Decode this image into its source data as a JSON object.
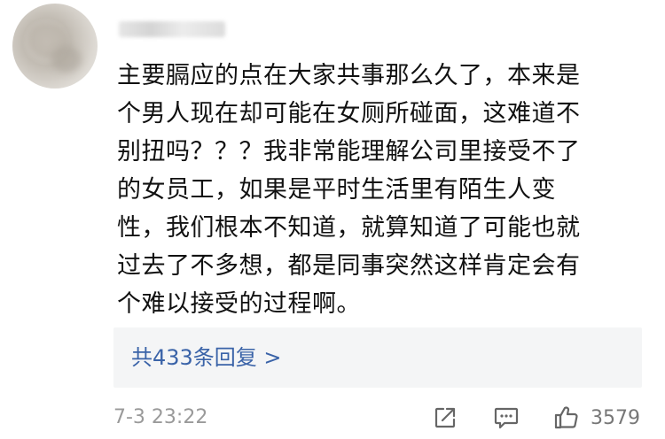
{
  "comment": {
    "lines": [
      "主要膈应的点在大家共事那么久了，本来是",
      "个男人现在却可能在女厕所碰面，这难道不",
      "别扭吗？？？我非常能理解公司里接受不了",
      "的女员工，如果是平时生活里有陌生人变",
      "性，我们根本不知道，就算知道了可能也就",
      "过去了不多想，都是同事突然这样肯定会有",
      "个难以接受的过程啊。"
    ]
  },
  "replies": {
    "label": "共433条回复 >"
  },
  "footer": {
    "timestamp": "7-3 23:22",
    "like_count": "3579"
  },
  "icons": {
    "share": "share-icon",
    "reply": "comment-icon",
    "like": "thumbs-up-icon"
  },
  "colors": {
    "link": "#3a63a8",
    "meta_text": "#9a9a9a",
    "reply_box_bg": "#f4f5f6"
  }
}
